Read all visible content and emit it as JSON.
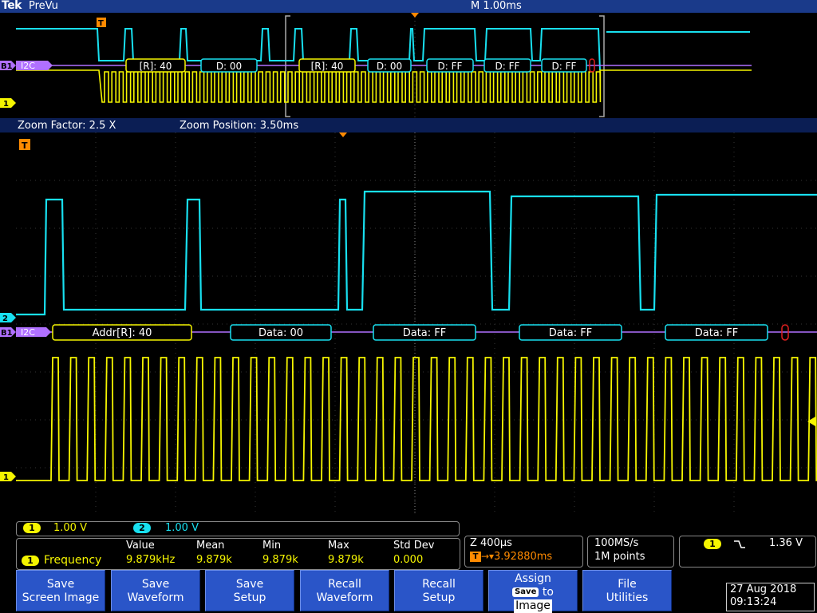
{
  "header": {
    "brand": "Tek",
    "mode": "PreVu",
    "timebase": "M 1.00ms"
  },
  "colors": {
    "ch1": "#f5f500",
    "ch2": "#18e0f0",
    "bus": "#b070ff",
    "trigger": "#ff8a00",
    "background": "#000000",
    "button": "#2a55c8"
  },
  "icons": {
    "trigger_marker": "T-marker-icon",
    "ch1_marker": "ch1-marker-icon",
    "ch2_marker": "ch2-marker-icon",
    "bus_marker": "bus-b1-marker-icon"
  },
  "overview": {
    "bus_label": "I2C",
    "bus_marker": "B1",
    "ch1_marker": "1",
    "trigger_marker": "T",
    "decodes": [
      "[R]: 40",
      "D: 00",
      "[R]: 40",
      "D: 00",
      "D: FF",
      "D: FF",
      "D: FF"
    ]
  },
  "zoom": {
    "factor": "Zoom Factor: 2.5 X",
    "position": "Zoom Position: 3.50ms"
  },
  "main": {
    "bus_label": "I2C",
    "bus_marker": "B1",
    "ch1_marker": "1",
    "ch2_marker": "2",
    "trigger_marker": "T",
    "decodes": [
      "Addr[R]: 40",
      "Data: 00",
      "Data: FF",
      "Data: FF",
      "Data: FF"
    ]
  },
  "channels": [
    {
      "id": "1",
      "scale": "1.00 V"
    },
    {
      "id": "2",
      "scale": "1.00 V"
    }
  ],
  "measurement": {
    "badge": "1",
    "name": "Frequency",
    "headers": [
      "Value",
      "Mean",
      "Min",
      "Max",
      "Std Dev"
    ],
    "values": [
      "9.879kHz",
      "9.879k",
      "9.879k",
      "9.879k",
      "0.000"
    ]
  },
  "horizontal": {
    "zoom_scale": "Z 400µs",
    "trigger_position": "3.92880ms",
    "trigger_pos_icon": "T",
    "trigger_pos_arrow": "→▾"
  },
  "acquisition": {
    "sample_rate": "100MS/s",
    "record_length": "1M points"
  },
  "trigger": {
    "source": "1",
    "slope_icon": "falling-edge-icon",
    "slope_glyph": "⌐ˎ",
    "level": "1.36 V"
  },
  "buttons": [
    {
      "line1": "Save",
      "line2": "Screen Image"
    },
    {
      "line1": "Save",
      "line2": "Waveform"
    },
    {
      "line1": "Save",
      "line2": "Setup"
    },
    {
      "line1": "Recall",
      "line2": "Waveform"
    },
    {
      "line1": "Recall",
      "line2": "Setup"
    },
    {
      "line1": "Assign",
      "chip": "Save",
      "mid": "to",
      "line2": "Image"
    },
    {
      "line1": "File",
      "line2": "Utilities"
    }
  ],
  "datetime": {
    "date": "27 Aug 2018",
    "time": "09:13:24"
  }
}
